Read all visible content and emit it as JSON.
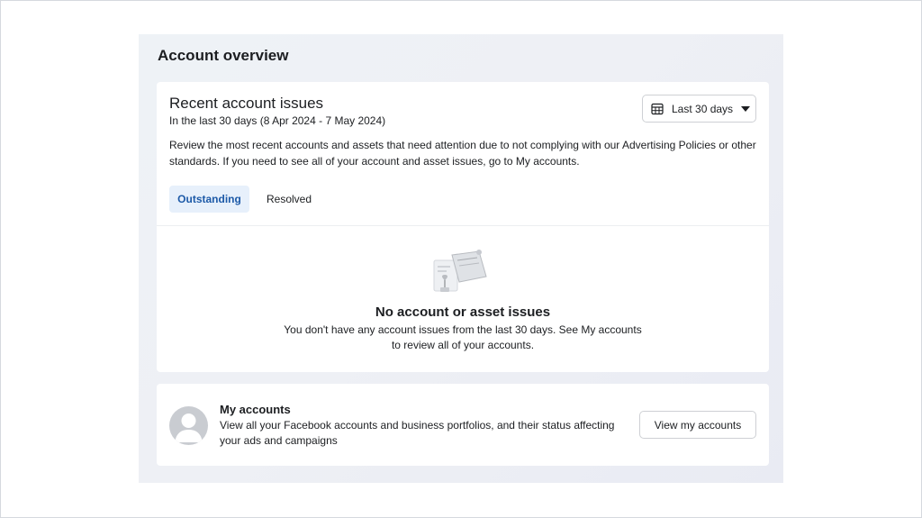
{
  "overview": {
    "title": "Account overview"
  },
  "issues": {
    "title": "Recent account issues",
    "subtitle": "In the last 30 days (8 Apr 2024 - 7 May 2024)",
    "date_filter": {
      "label": "Last 30 days",
      "icon": "calendar-icon"
    },
    "description": "Review the most recent accounts and assets that need attention due to not complying with our Advertising Policies or other standards. If you need to see all of your account and asset issues, go to My accounts.",
    "tabs": [
      {
        "label": "Outstanding",
        "selected": true
      },
      {
        "label": "Resolved",
        "selected": false
      }
    ],
    "empty": {
      "title": "No account or asset issues",
      "text": "You don't have any account issues from the last 30 days. See My accounts to review all of your accounts."
    }
  },
  "my_accounts": {
    "title": "My accounts",
    "description": "View all your Facebook accounts and business portfolios, and their status affecting your ads and campaigns",
    "button_label": "View my accounts"
  },
  "colors": {
    "accent": "#1d5aa8",
    "tab_selected_bg": "#e7f0fb",
    "panel_bg": "#eef1f5"
  }
}
